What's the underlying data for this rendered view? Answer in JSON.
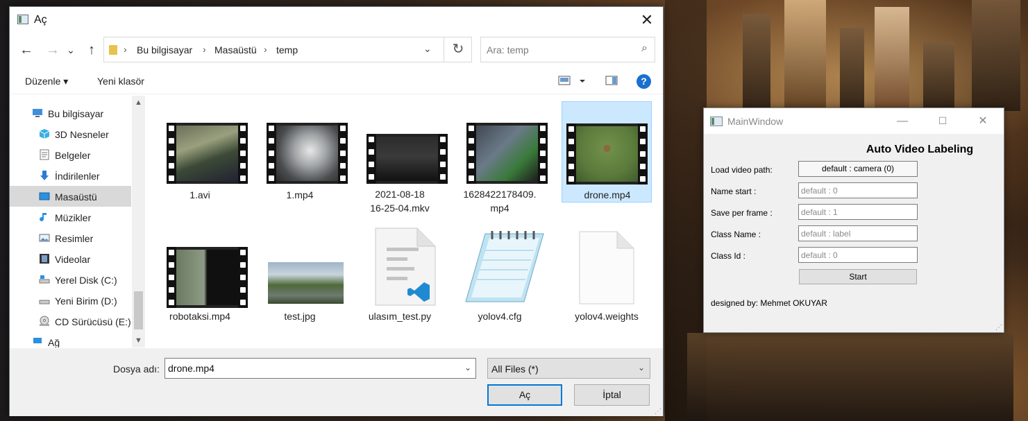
{
  "dialog": {
    "title": "Aç",
    "nav": {
      "back": "←",
      "forward": "→",
      "recent": "⌄",
      "up": "↑"
    },
    "address": {
      "crumbs": [
        "Bu bilgisayar",
        "Masaüstü",
        "temp"
      ],
      "refresh_icon": "refresh-icon"
    },
    "search": {
      "placeholder": "Ara: temp"
    },
    "commands": {
      "organize": "Düzenle ▾",
      "new_folder": "Yeni klasör"
    },
    "sidebar": {
      "items": [
        {
          "label": "Bu bilgisayar",
          "icon": "pc-icon"
        },
        {
          "label": "3D Nesneler",
          "icon": "cube-icon"
        },
        {
          "label": "Belgeler",
          "icon": "document-icon"
        },
        {
          "label": "İndirilenler",
          "icon": "download-icon"
        },
        {
          "label": "Masaüstü",
          "icon": "desktop-icon",
          "selected": true
        },
        {
          "label": "Müzikler",
          "icon": "music-icon"
        },
        {
          "label": "Resimler",
          "icon": "pictures-icon"
        },
        {
          "label": "Videolar",
          "icon": "video-icon"
        },
        {
          "label": "Yerel Disk (C:)",
          "icon": "drive-icon"
        },
        {
          "label": "Yeni Birim (D:)",
          "icon": "drive-icon"
        },
        {
          "label": "CD Sürücüsü (E:)",
          "icon": "cd-icon"
        },
        {
          "label": "Ağ",
          "icon": "network-icon"
        }
      ]
    },
    "files": [
      {
        "name": "1.avi",
        "type": "video"
      },
      {
        "name": "1.mp4",
        "type": "video"
      },
      {
        "name": "2021-08-18 16-25-04.mkv",
        "type": "video"
      },
      {
        "name": "1628422178409.mp4",
        "type": "video"
      },
      {
        "name": "drone.mp4",
        "type": "video",
        "selected": true
      },
      {
        "name": "robotaksi.mp4",
        "type": "video"
      },
      {
        "name": "test.jpg",
        "type": "image"
      },
      {
        "name": "ulasım_test.py",
        "type": "python"
      },
      {
        "name": "yolov4.cfg",
        "type": "notepad"
      },
      {
        "name": "yolov4.weights",
        "type": "blank"
      }
    ],
    "bottom": {
      "filename_label": "Dosya adı:",
      "filename_value": "drone.mp4",
      "filter_value": "All Files (*)",
      "open_button": "Aç",
      "cancel_button": "İptal"
    }
  },
  "mainwindow": {
    "title": "MainWindow",
    "heading": "Auto Video Labeling",
    "load_label": "Load video path:",
    "load_button": "default : camera (0)",
    "name_start_label": "Name start :",
    "name_start_placeholder": "default : 0",
    "save_per_frame_label": "Save per frame :",
    "save_per_frame_placeholder": "default : 1",
    "class_name_label": "Class Name :",
    "class_name_placeholder": "default : label",
    "class_id_label": "Class Id :",
    "class_id_placeholder": "default : 0",
    "start_button": "Start",
    "footer": "designed by: Mehmet OKUYAR"
  },
  "colors": {
    "accent": "#0078d7",
    "selection": "#cce8ff",
    "sidebar_selection": "#d9d9d9"
  }
}
